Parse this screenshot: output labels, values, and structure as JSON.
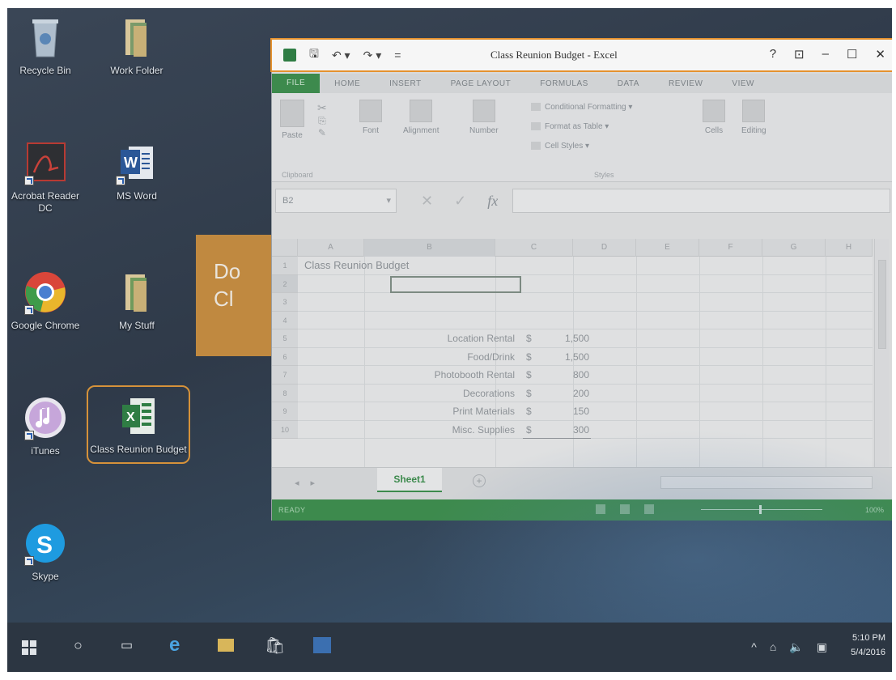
{
  "desktop": {
    "icons": [
      {
        "label": "Recycle Bin"
      },
      {
        "label": "Work Folder"
      },
      {
        "label": "Acrobat Reader DC"
      },
      {
        "label": "MS Word"
      },
      {
        "label": "Google Chrome"
      },
      {
        "label": "My Stuff"
      },
      {
        "label": "iTunes"
      },
      {
        "label": "Class Reunion Budget"
      },
      {
        "label": "Skype"
      }
    ],
    "tile_text": "Do\nCl"
  },
  "excel": {
    "title": "Class Reunion Budget - Excel",
    "title_buttons": [
      "?",
      "⊡",
      "–",
      "☐",
      "✕"
    ],
    "tabs": [
      "FILE",
      "HOME",
      "INSERT",
      "PAGE LAYOUT",
      "FORMULAS",
      "DATA",
      "REVIEW",
      "VIEW"
    ],
    "ribbon": {
      "paste": "Paste",
      "font": "Font",
      "alignment": "Alignment",
      "number": "Number",
      "conditional_formatting": "Conditional Formatting ▾",
      "format_as_table": "Format as Table ▾",
      "cell_styles": "Cell Styles ▾",
      "cells": "Cells",
      "editing": "Editing",
      "clipboard_label": "Clipboard",
      "styles_label": "Styles"
    },
    "name_box": "B2",
    "fx": "fx",
    "columns": [
      "A",
      "B",
      "C",
      "D",
      "E",
      "F",
      "G",
      "H"
    ],
    "rows": [
      "1",
      "2",
      "3",
      "4",
      "5",
      "6",
      "7",
      "8",
      "9",
      "10"
    ],
    "sheet_title": "Class Reunion Budget",
    "budget_items": [
      {
        "name": "Location Rental",
        "currency": "$",
        "amount": "1,500"
      },
      {
        "name": "Food/Drink",
        "currency": "$",
        "amount": "1,500"
      },
      {
        "name": "Photobooth Rental",
        "currency": "$",
        "amount": "800"
      },
      {
        "name": "Decorations",
        "currency": "$",
        "amount": "200"
      },
      {
        "name": "Print Materials",
        "currency": "$",
        "amount": "150"
      },
      {
        "name": "Misc. Supplies",
        "currency": "$",
        "amount": "300"
      }
    ],
    "sheet_tab": "Sheet1",
    "status": "READY",
    "zoom": "100%"
  },
  "taskbar": {
    "time": "5:10 PM",
    "date": "5/4/2016"
  },
  "colors": {
    "excel_green": "#3d8a4d",
    "highlight_orange": "#e5922f"
  }
}
